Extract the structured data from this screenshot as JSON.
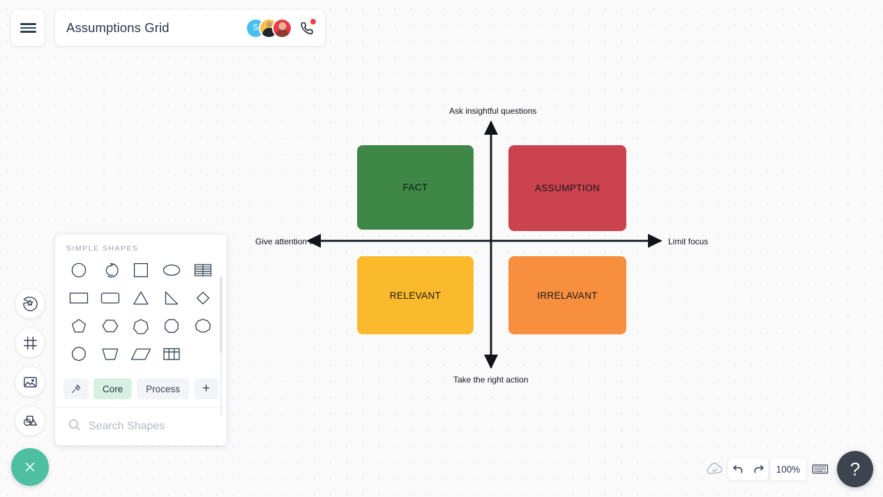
{
  "app": {
    "title": "Assumptions Grid",
    "hamburger_icon": "hamburger-menu-icon",
    "call_icon": "phone-call-icon"
  },
  "collaborators": [
    {
      "name": "avatar-s",
      "initial": "S",
      "color": "#49c0ec"
    },
    {
      "name": "avatar-2",
      "initial": "",
      "color": "#f6c445"
    },
    {
      "name": "avatar-3",
      "initial": "",
      "color": "#e8394a"
    }
  ],
  "left_rail": {
    "items": [
      {
        "name": "theme-icon",
        "label": "Theme"
      },
      {
        "name": "frame-icon",
        "label": "Frame"
      },
      {
        "name": "image-icon",
        "label": "Image"
      },
      {
        "name": "shapes-icon",
        "label": "Shapes"
      }
    ],
    "close_label": "×",
    "close_color": "#4ebfa0"
  },
  "shapes_panel": {
    "section_title": "SIMPLE SHAPES",
    "shapes": [
      "circle",
      "arc",
      "square",
      "ellipse",
      "table-rows",
      "rectangle",
      "rounded-rectangle",
      "triangle",
      "right-triangle",
      "diamond",
      "pentagon",
      "hexagon",
      "heptagon",
      "octagon",
      "nonagon",
      "decagon",
      "trapezoid",
      "parallelogram",
      "grid-table"
    ],
    "tabs": [
      {
        "name": "pin",
        "label": ""
      },
      {
        "name": "core",
        "label": "Core",
        "active": true
      },
      {
        "name": "process",
        "label": "Process",
        "active": false
      },
      {
        "name": "add",
        "label": "+"
      }
    ],
    "search": {
      "placeholder": "Search Shapes",
      "value": "",
      "icon": "search-icon"
    },
    "more_icon": "more-vertical-icon"
  },
  "chart_data": {
    "type": "quadrant",
    "title": "Assumptions Grid",
    "axes": {
      "top_label": "Ask insightful questions",
      "bottom_label": "Take the right action",
      "left_label": "Give attention to",
      "right_label": "Limit focus"
    },
    "quadrants": [
      {
        "name": "fact",
        "label": "FACT",
        "color": "#3e8746",
        "position": "top-left"
      },
      {
        "name": "assumption",
        "label": "ASSUMPTION",
        "color": "#cc4350",
        "position": "top-right"
      },
      {
        "name": "relevant",
        "label": "RELEVANT",
        "color": "#fbba2b",
        "position": "bottom-left"
      },
      {
        "name": "irrelevant",
        "label": "IRRELAVANT",
        "color": "#f78f3f",
        "position": "bottom-right"
      }
    ]
  },
  "bottom_toolbar": {
    "cloud_icon": "cloud-saved-icon",
    "undo_icon": "undo-icon",
    "redo_icon": "redo-icon",
    "zoom_level": "100%",
    "keyboard_icon": "keyboard-icon",
    "help_label": "?"
  }
}
